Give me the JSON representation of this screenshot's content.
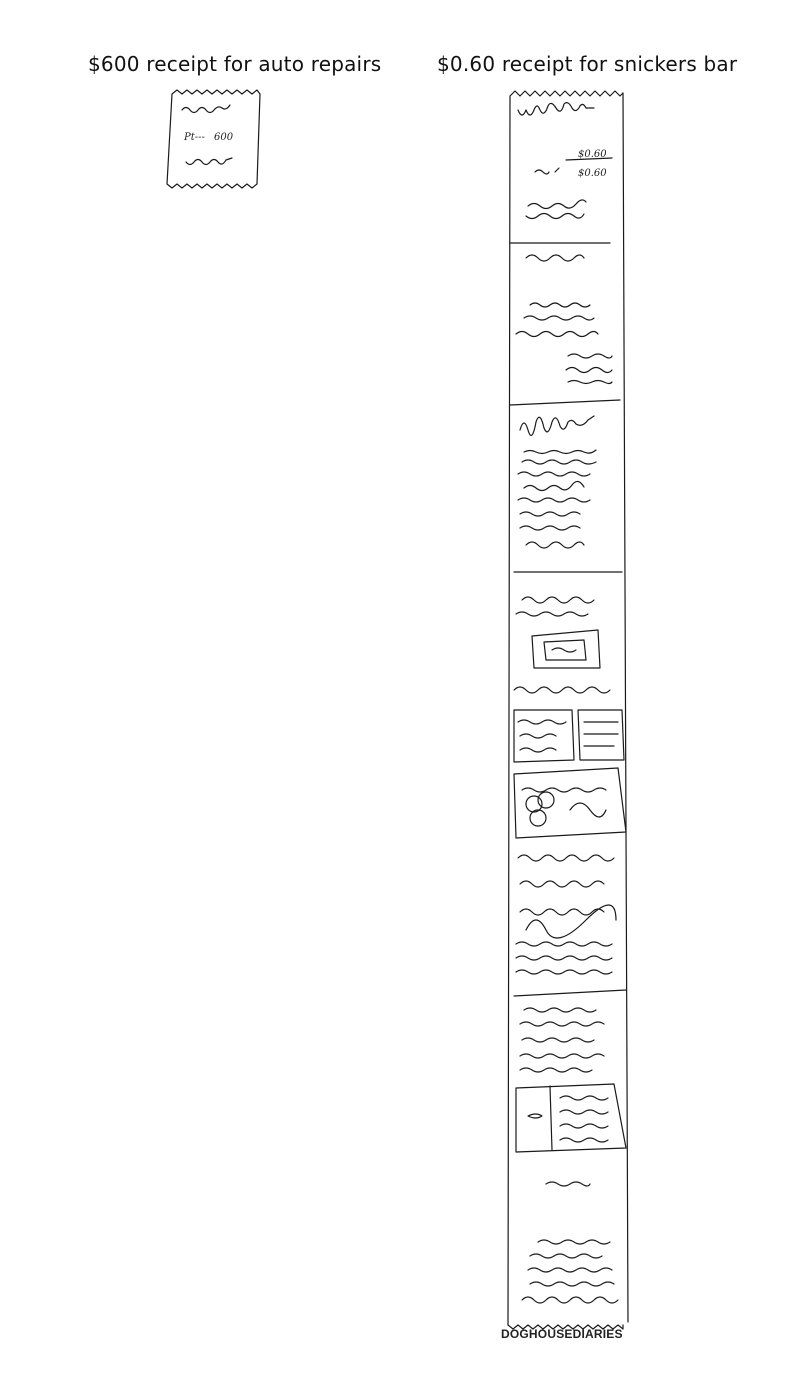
{
  "captions": {
    "left": "$600 receipt for auto repairs",
    "right": "$0.60 receipt for snickers bar"
  },
  "small_receipt": {
    "amount": "600"
  },
  "long_receipt": {
    "price": "$0.60",
    "total": "$0.60"
  },
  "credit": "DOGHOUSEDIARIES"
}
